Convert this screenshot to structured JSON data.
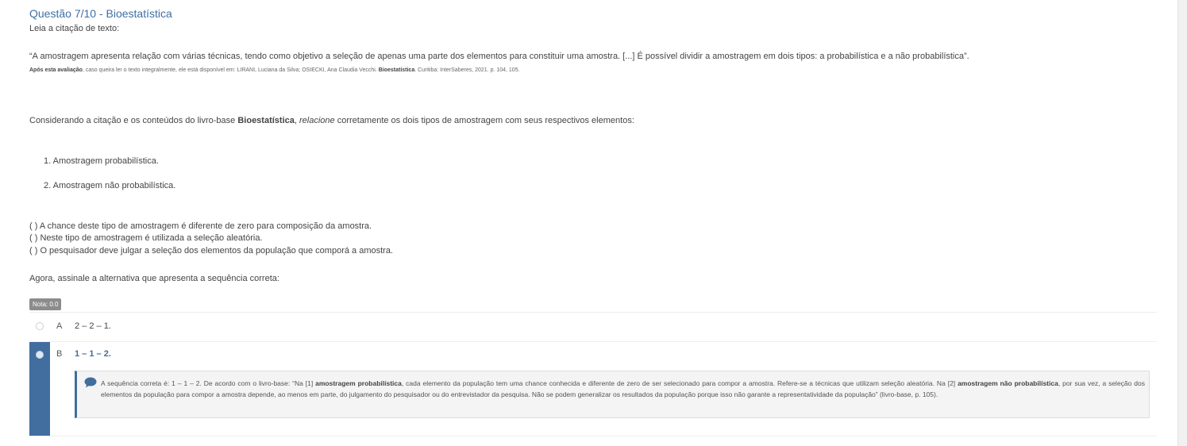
{
  "question": {
    "title": "Questão 7/10 - Bioestatística",
    "intro": "Leia a citação de texto:",
    "quote": "“A amostragem apresenta relação com várias técnicas, tendo como objetivo a seleção de apenas uma parte dos elementos para constituir uma amostra. [...] É possível dividir a amostragem em dois tipos: a probabilística e a não probabilística”.",
    "source_bold": "Após esta avaliação",
    "source_mid": ", caso queira ler o texto integralmente, ele está disponível em: LIRANI, Luciana da Silva; OSIECKI, Ana Claudia Vecchi. ",
    "source_book": "Bioestatística",
    "source_end": ". Curitiba: InterSaberes, 2021. p. 104, 105.",
    "prompt_a": "Considerando a citação e os conteúdos do livro-base ",
    "prompt_book": "Bioestatística",
    "prompt_comma": ", ",
    "prompt_italic": "relacione",
    "prompt_b": " corretamente os dois tipos de amostragem com seus respectivos elementos:",
    "items": [
      "1. Amostragem probabilística.",
      "2. Amostragem não probabilística."
    ],
    "statements": [
      "( ) A chance deste tipo de amostragem é diferente de zero para composição da amostra.",
      "( ) Neste tipo de amostragem é utilizada a seleção aleatória.",
      "( ) O pesquisador deve julgar a seleção dos elementos da população que comporá a amostra."
    ],
    "instruction": "Agora, assinale a alternativa que apresenta a sequência correta:",
    "nota": "Nota: 0.0"
  },
  "alternatives": [
    {
      "letter": "A",
      "text": "2 – 2 – 1."
    },
    {
      "letter": "B",
      "text": "1 – 1 – 2."
    }
  ],
  "feedback": {
    "t1": "A sequência correta é: 1 – 1 – 2. De acordo com o livro-base: “Na [1] ",
    "b1": "amostragem probabilística",
    "t2": ", cada elemento da população tem uma chance conhecida e diferente de zero de ser selecionado para compor a amostra. Refere-se a técnicas que utilizam seleção aleatória. Na [2] ",
    "b2": "amostragem não probabilística",
    "t3": ", por sua vez, a seleção dos elementos da população para compor a amostra depende, ao menos em parte, do julgamento do pesquisador ou do entrevistador da pesquisa. Não se podem generalizar os resultados da população porque isso não garante a representatividade da população” (livro-base, p. 105)."
  },
  "colors": {
    "accent": "#416d9f",
    "title": "#3f6fa6"
  }
}
